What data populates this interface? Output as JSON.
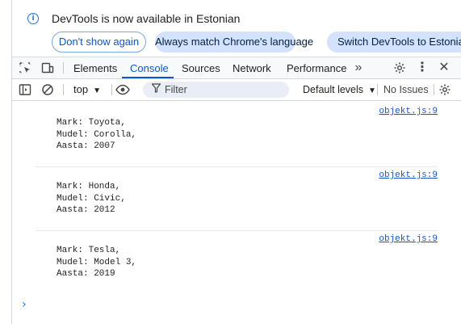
{
  "infobar": {
    "message": "DevTools is now available in Estonian",
    "dont_show": "Don't show again",
    "always_match": "Always match Chrome's language",
    "switch": "Switch DevTools to Estonian"
  },
  "tabs": [
    "Elements",
    "Console",
    "Sources",
    "Network",
    "Performance"
  ],
  "tab_active": "Console",
  "toolbar": {
    "context": "top",
    "filter_placeholder": "Filter",
    "levels": "Default levels",
    "issues": "No Issues"
  },
  "messages": [
    {
      "lines": "Mark: Toyota,\nMudel: Corolla,\nAasta: 2007",
      "source": "objekt.js:9"
    },
    {
      "lines": "Mark: Honda,\nMudel: Civic,\nAasta: 2012",
      "source": "objekt.js:9"
    },
    {
      "lines": "Mark: Tesla,\nMudel: Model 3,\nAasta: 2019",
      "source": "objekt.js:9"
    }
  ],
  "colors": {
    "accent": "#0b57d0",
    "link": "#1a55c8",
    "chip": "#d3e3fd"
  }
}
